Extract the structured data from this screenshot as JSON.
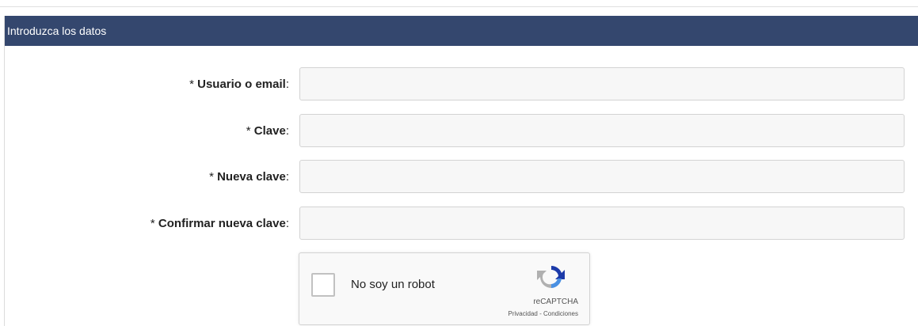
{
  "panel": {
    "title": "Introduzca los datos"
  },
  "form": {
    "fields": [
      {
        "required_mark": "* ",
        "label": "Usuario o email",
        "colon": ":",
        "value": "",
        "placeholder": ""
      },
      {
        "required_mark": "* ",
        "label": "Clave",
        "colon": ":",
        "value": "",
        "placeholder": ""
      },
      {
        "required_mark": "* ",
        "label": "Nueva clave",
        "colon": ":",
        "value": "",
        "placeholder": ""
      },
      {
        "required_mark": "* ",
        "label": "Confirmar nueva clave",
        "colon": ":",
        "value": "",
        "placeholder": ""
      }
    ]
  },
  "captcha": {
    "label": "No soy un robot",
    "brand": "reCAPTCHA",
    "privacy": "Privacidad",
    "separator": " - ",
    "terms": "Condiciones",
    "icon": "recaptcha-logo-icon"
  },
  "colors": {
    "header_bg": "#34476e",
    "field_bg": "#f7f7f7"
  }
}
